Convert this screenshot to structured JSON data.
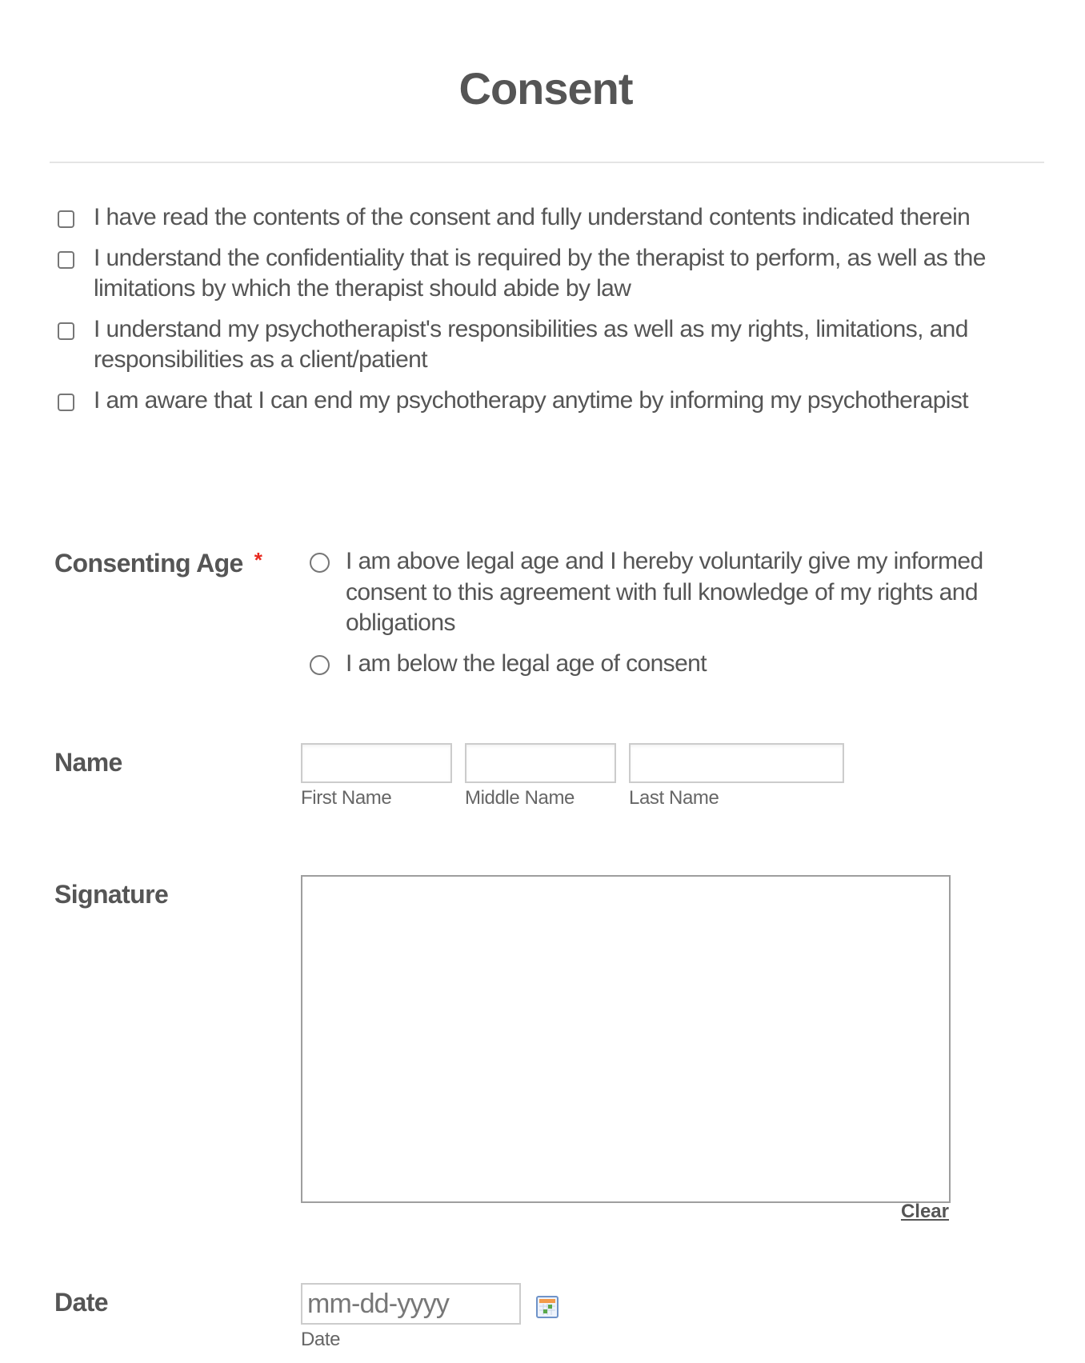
{
  "form": {
    "title": "Consent",
    "agreements": [
      {
        "text": "I have read the contents of the consent and fully understand contents indicated therein",
        "checked": false
      },
      {
        "text": "I understand the confidentiality that is required by the therapist to perform, as well as the limitations by which the therapist should abide by law",
        "checked": false
      },
      {
        "text": "I understand my psychotherapist's responsibilities as well as my rights, limitations, and responsibilities as a client/patient",
        "checked": false
      },
      {
        "text": "I am aware that I can end my psychotherapy anytime by informing my psychotherapist",
        "checked": false
      }
    ],
    "consenting_age": {
      "label": "Consenting Age",
      "required_marker": "*",
      "options": [
        {
          "text": "I am above legal age and I hereby voluntarily give my informed consent to this agreement with full knowledge of my rights and obligations",
          "selected": false
        },
        {
          "text": "I am below the legal age of consent",
          "selected": false
        }
      ]
    },
    "name": {
      "label": "Name",
      "first_name": {
        "value": "",
        "sublabel": "First Name"
      },
      "middle_name": {
        "value": "",
        "sublabel": "Middle Name"
      },
      "last_name": {
        "value": "",
        "sublabel": "Last Name"
      }
    },
    "signature": {
      "label": "Signature",
      "clear_label": "Clear"
    },
    "date": {
      "label": "Date",
      "value": "",
      "placeholder": "mm-dd-yyyy",
      "sublabel": "Date",
      "icon": "calendar-icon"
    }
  },
  "colors": {
    "text": "#555555",
    "required": "#e8281e",
    "input_border": "#cccccc",
    "signature_border": "#9e9e9e",
    "divider": "#e4e4e4"
  }
}
